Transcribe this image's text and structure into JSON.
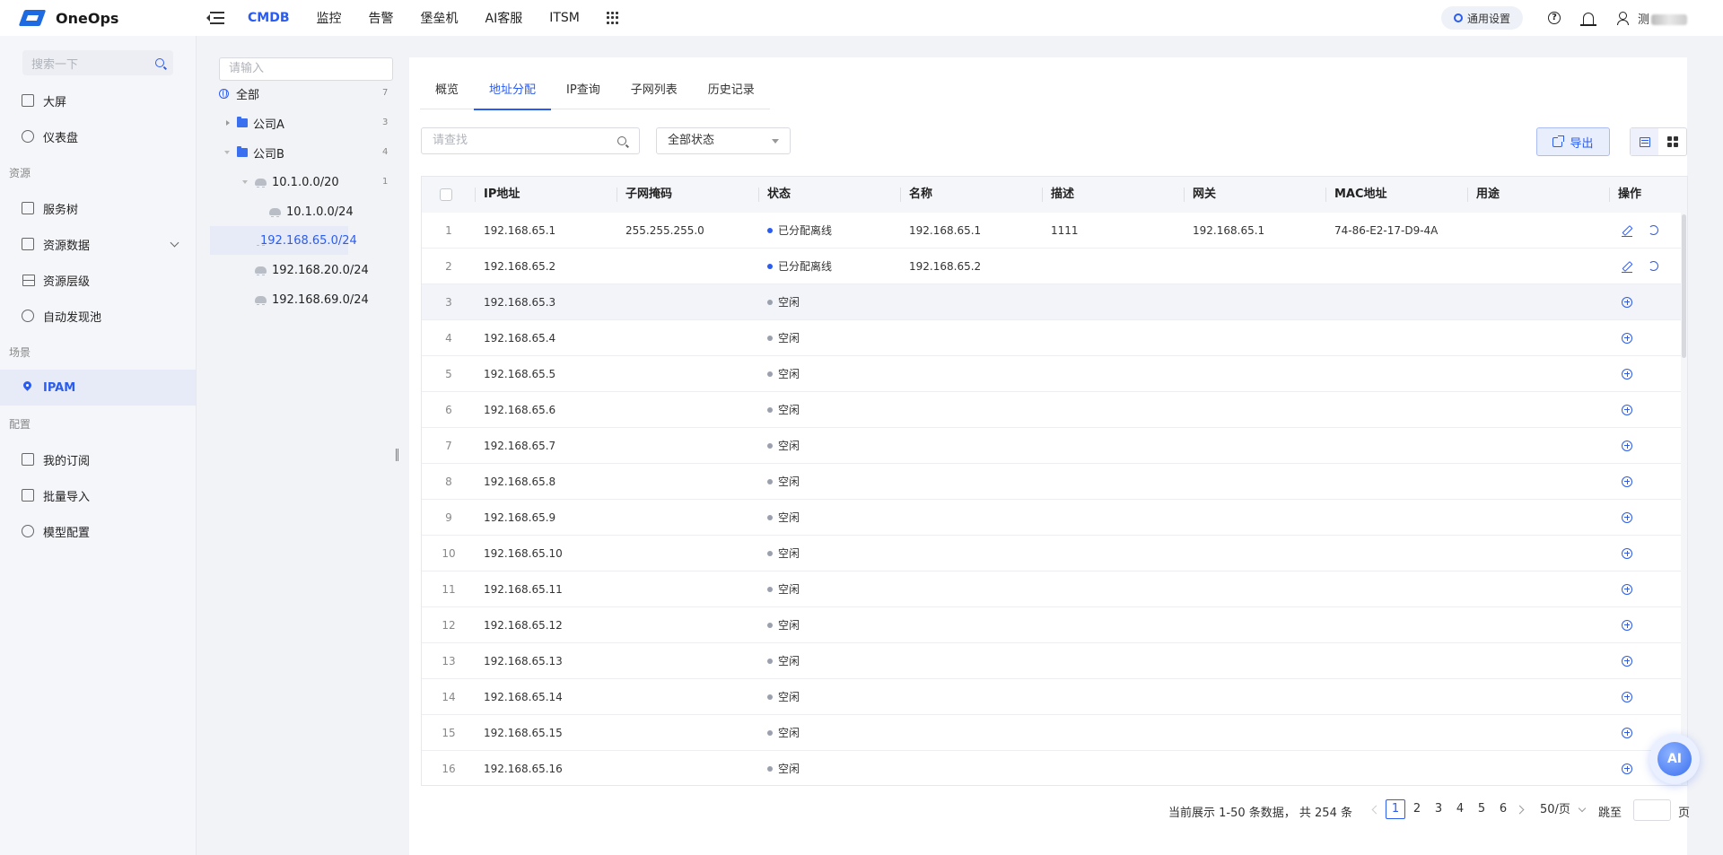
{
  "app": {
    "name": "OneOps"
  },
  "topnav": [
    {
      "label": "CMDB",
      "active": true
    },
    {
      "label": "监控"
    },
    {
      "label": "告警"
    },
    {
      "label": "堡垒机"
    },
    {
      "label": "AI客服"
    },
    {
      "label": "ITSM"
    }
  ],
  "header_right": {
    "settings_label": "通用设置",
    "user_name": "测"
  },
  "sidebar": {
    "search_placeholder": "搜索一下",
    "items": [
      {
        "type": "item",
        "label": "大屏",
        "icon": "monitor-icon"
      },
      {
        "type": "item",
        "label": "仪表盘",
        "icon": "dashboard-icon"
      },
      {
        "type": "group",
        "label": "资源"
      },
      {
        "type": "item",
        "label": "服务树",
        "icon": "tree-icon"
      },
      {
        "type": "item",
        "label": "资源数据",
        "icon": "database-icon",
        "expandable": true
      },
      {
        "type": "item",
        "label": "资源层级",
        "icon": "layers-icon"
      },
      {
        "type": "item",
        "label": "自动发现池",
        "icon": "discover-icon"
      },
      {
        "type": "group",
        "label": "场景"
      },
      {
        "type": "item",
        "label": "IPAM",
        "icon": "pin-icon",
        "active": true
      },
      {
        "type": "group",
        "label": "配置"
      },
      {
        "type": "item",
        "label": "我的订阅",
        "icon": "bookmark-icon"
      },
      {
        "type": "item",
        "label": "批量导入",
        "icon": "import-icon"
      },
      {
        "type": "item",
        "label": "模型配置",
        "icon": "model-icon"
      }
    ]
  },
  "tree": {
    "search_placeholder": "请输入",
    "nodes": [
      {
        "label": "全部",
        "count": "7",
        "icon": "globe-icon",
        "level": 0
      },
      {
        "label": "公司A",
        "count": "3",
        "icon": "folder-icon",
        "level": 1,
        "caret": "right"
      },
      {
        "label": "公司B",
        "count": "4",
        "icon": "folder-icon",
        "level": 1,
        "caret": "down"
      },
      {
        "label": "10.1.0.0/20",
        "count": "1",
        "icon": "cloud-icon",
        "level": 2,
        "caret": "down"
      },
      {
        "label": "10.1.0.0/24",
        "count": "",
        "icon": "cloud-icon",
        "level": 3
      },
      {
        "label": "192.168.65.0/24",
        "count": "",
        "icon": "cloud-icon",
        "level": 2,
        "selected": true
      },
      {
        "label": "192.168.20.0/24",
        "count": "",
        "icon": "cloud-icon",
        "level": 2
      },
      {
        "label": "192.168.69.0/24",
        "count": "",
        "icon": "cloud-icon",
        "level": 2
      }
    ]
  },
  "tabs": [
    {
      "label": "概览"
    },
    {
      "label": "地址分配",
      "active": true
    },
    {
      "label": "IP查询"
    },
    {
      "label": "子网列表"
    },
    {
      "label": "历史记录"
    }
  ],
  "toolbar": {
    "search_placeholder": "请查找",
    "status_select": "全部状态",
    "export_label": "导出"
  },
  "table": {
    "columns": [
      "IP地址",
      "子网掩码",
      "状态",
      "名称",
      "描述",
      "网关",
      "MAC地址",
      "用途",
      "操作"
    ],
    "status_colors": {
      "已分配离线": "#2b5cf0",
      "空闲": "#9aa0ad"
    },
    "rows": [
      {
        "idx": "1",
        "ip": "192.168.65.1",
        "mask": "255.255.255.0",
        "status": "已分配离线",
        "name": "192.168.65.1",
        "desc": "1111",
        "gateway": "192.168.65.1",
        "mac": "74-86-E2-17-D9-4A",
        "usage": "",
        "actions": "edit"
      },
      {
        "idx": "2",
        "ip": "192.168.65.2",
        "mask": "",
        "status": "已分配离线",
        "name": "192.168.65.2",
        "desc": "",
        "gateway": "",
        "mac": "",
        "usage": "",
        "actions": "edit"
      },
      {
        "idx": "3",
        "ip": "192.168.65.3",
        "mask": "",
        "status": "空闲",
        "name": "",
        "desc": "",
        "gateway": "",
        "mac": "",
        "usage": "",
        "actions": "add",
        "highlight": true
      },
      {
        "idx": "4",
        "ip": "192.168.65.4",
        "mask": "",
        "status": "空闲",
        "name": "",
        "desc": "",
        "gateway": "",
        "mac": "",
        "usage": "",
        "actions": "add"
      },
      {
        "idx": "5",
        "ip": "192.168.65.5",
        "mask": "",
        "status": "空闲",
        "name": "",
        "desc": "",
        "gateway": "",
        "mac": "",
        "usage": "",
        "actions": "add"
      },
      {
        "idx": "6",
        "ip": "192.168.65.6",
        "mask": "",
        "status": "空闲",
        "name": "",
        "desc": "",
        "gateway": "",
        "mac": "",
        "usage": "",
        "actions": "add"
      },
      {
        "idx": "7",
        "ip": "192.168.65.7",
        "mask": "",
        "status": "空闲",
        "name": "",
        "desc": "",
        "gateway": "",
        "mac": "",
        "usage": "",
        "actions": "add"
      },
      {
        "idx": "8",
        "ip": "192.168.65.8",
        "mask": "",
        "status": "空闲",
        "name": "",
        "desc": "",
        "gateway": "",
        "mac": "",
        "usage": "",
        "actions": "add"
      },
      {
        "idx": "9",
        "ip": "192.168.65.9",
        "mask": "",
        "status": "空闲",
        "name": "",
        "desc": "",
        "gateway": "",
        "mac": "",
        "usage": "",
        "actions": "add"
      },
      {
        "idx": "10",
        "ip": "192.168.65.10",
        "mask": "",
        "status": "空闲",
        "name": "",
        "desc": "",
        "gateway": "",
        "mac": "",
        "usage": "",
        "actions": "add"
      },
      {
        "idx": "11",
        "ip": "192.168.65.11",
        "mask": "",
        "status": "空闲",
        "name": "",
        "desc": "",
        "gateway": "",
        "mac": "",
        "usage": "",
        "actions": "add"
      },
      {
        "idx": "12",
        "ip": "192.168.65.12",
        "mask": "",
        "status": "空闲",
        "name": "",
        "desc": "",
        "gateway": "",
        "mac": "",
        "usage": "",
        "actions": "add"
      },
      {
        "idx": "13",
        "ip": "192.168.65.13",
        "mask": "",
        "status": "空闲",
        "name": "",
        "desc": "",
        "gateway": "",
        "mac": "",
        "usage": "",
        "actions": "add"
      },
      {
        "idx": "14",
        "ip": "192.168.65.14",
        "mask": "",
        "status": "空闲",
        "name": "",
        "desc": "",
        "gateway": "",
        "mac": "",
        "usage": "",
        "actions": "add"
      },
      {
        "idx": "15",
        "ip": "192.168.65.15",
        "mask": "",
        "status": "空闲",
        "name": "",
        "desc": "",
        "gateway": "",
        "mac": "",
        "usage": "",
        "actions": "add"
      },
      {
        "idx": "16",
        "ip": "192.168.65.16",
        "mask": "",
        "status": "空闲",
        "name": "",
        "desc": "",
        "gateway": "",
        "mac": "",
        "usage": "",
        "actions": "add"
      }
    ]
  },
  "pagination": {
    "summary": "当前展示 1-50 条数据， 共 254 条",
    "pages": [
      "1",
      "2",
      "3",
      "4",
      "5",
      "6"
    ],
    "current": "1",
    "page_size": "50/页",
    "jump_label": "跳至",
    "page_suffix": "页"
  },
  "ai_bubble": {
    "label": "AI"
  },
  "colors": {
    "accent": "#2b5cf0",
    "sidebar_bg": "#f5f6fa",
    "page_bg": "#f2f3f7"
  }
}
